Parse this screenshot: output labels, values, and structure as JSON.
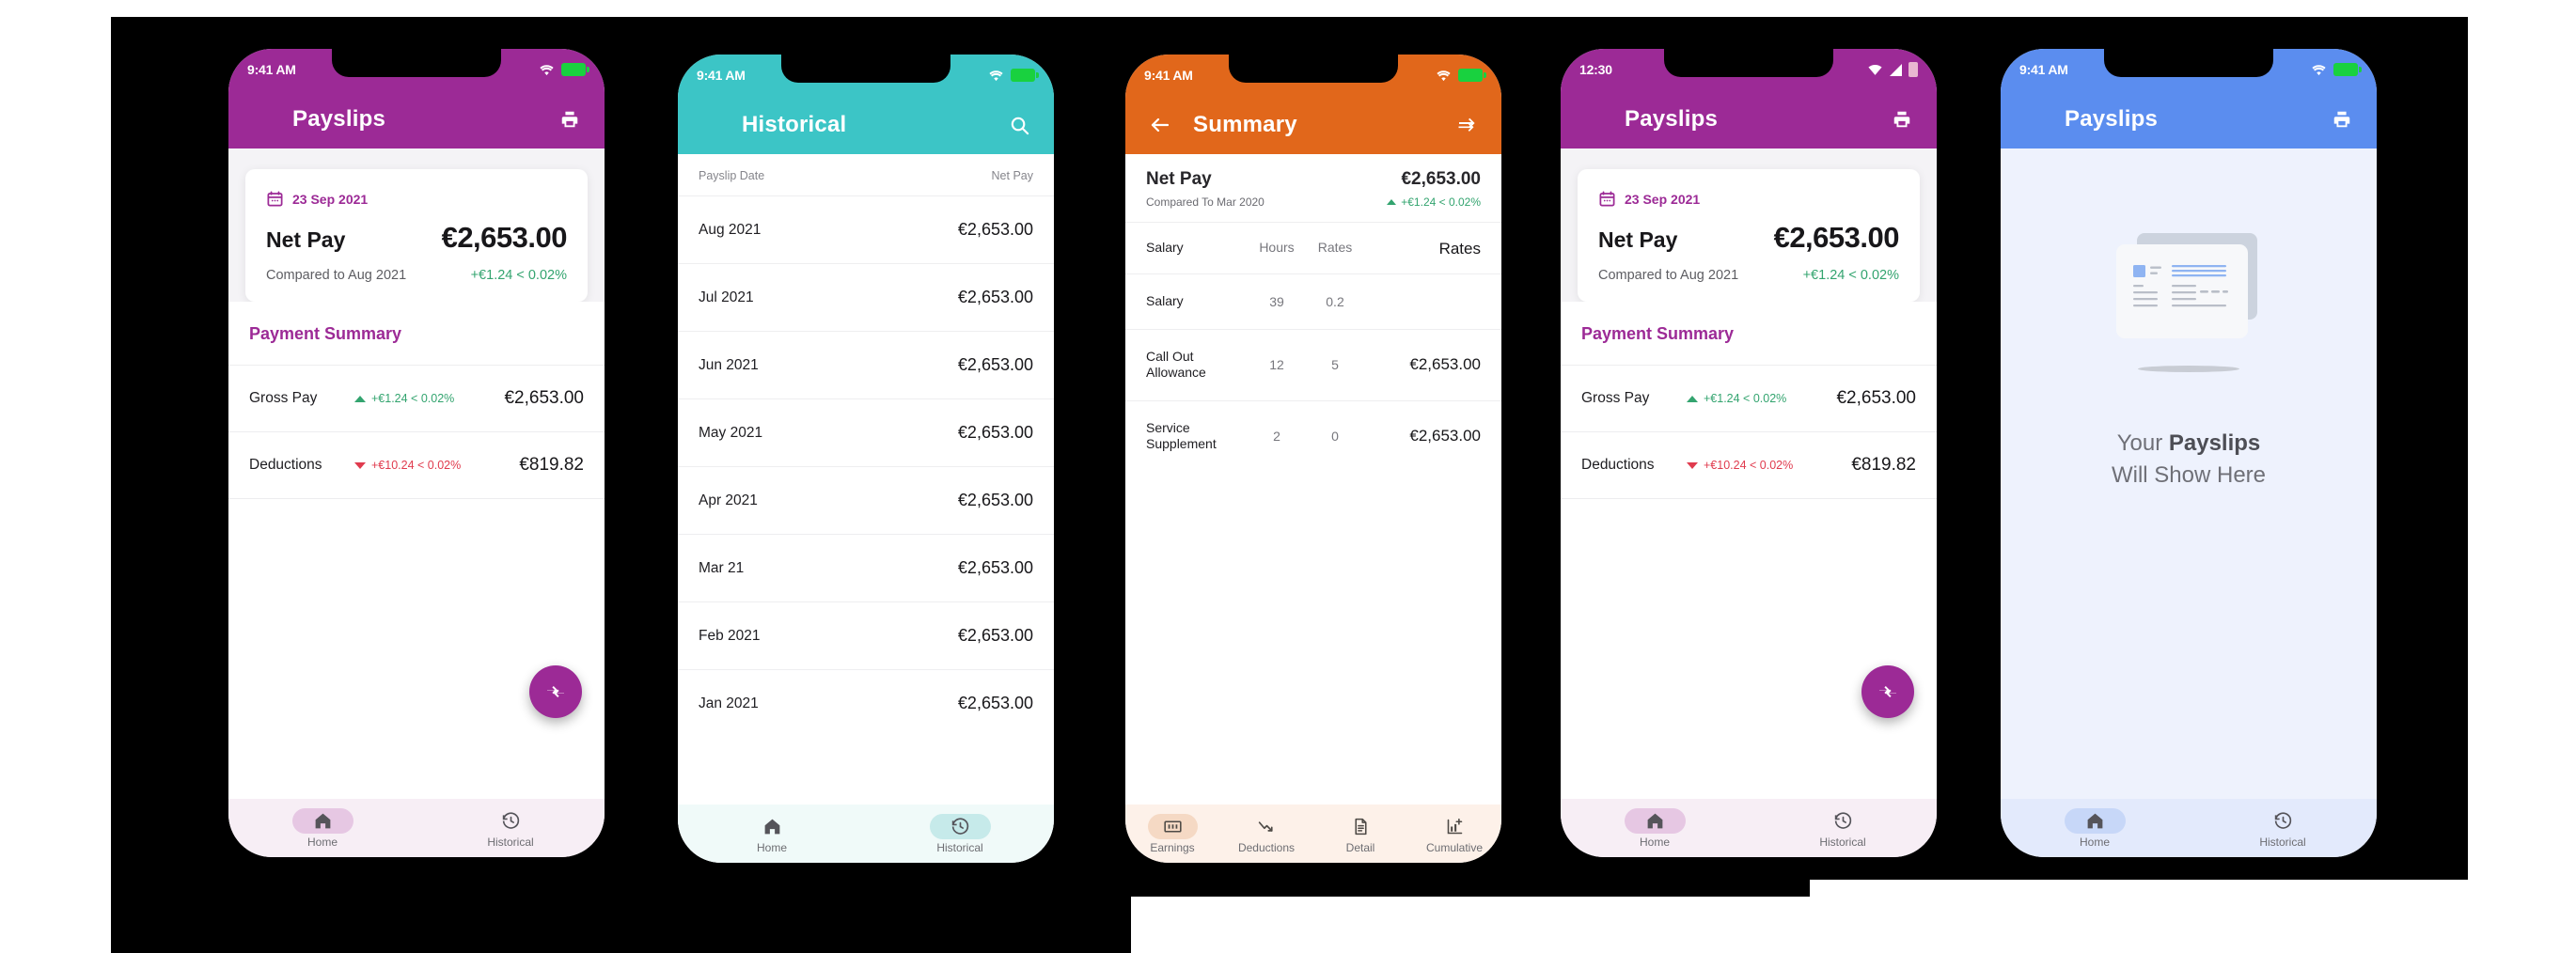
{
  "common": {
    "currency_amount": "€2,653.00",
    "net_pay_label": "Net Pay",
    "home_label": "Home",
    "historical_label": "Historical",
    "print_icon": "print-icon",
    "menu_icon": "hamburger-menu-icon",
    "colors": {
      "purple": "#9c2a96",
      "teal": "#3cc5c6",
      "orange": "#e1671b",
      "blue": "#5b8def",
      "green": "#33a46f",
      "red": "#e03b4e"
    }
  },
  "phone1": {
    "status": {
      "time": "9:41 AM",
      "wifi": "wifi-icon",
      "battery": "battery-full-icon"
    },
    "appbar": {
      "title": "Payslips",
      "menu": "hamburger-menu-icon",
      "action": "print-icon",
      "color": "#9c2a96"
    },
    "card": {
      "date": "23 Sep 2021",
      "net_pay_label": "Net Pay",
      "net_pay_amount": "€2,653.00",
      "compared_label": "Compared to Aug 2021",
      "delta": "+€1.24 < 0.02%"
    },
    "payment_summary": {
      "title": "Payment Summary",
      "rows": [
        {
          "name": "Gross Pay",
          "change": "+€1.24 < 0.02%",
          "direction": "up",
          "value": "€2,653.00"
        },
        {
          "name": "Deductions",
          "change": "+€10.24 < 0.02%",
          "direction": "down",
          "value": "€819.82"
        }
      ]
    },
    "fab": "compare-arrows-icon",
    "nav": {
      "active": "Home",
      "items": [
        {
          "label": "Home",
          "icon": "home-icon"
        },
        {
          "label": "Historical",
          "icon": "history-icon"
        }
      ]
    }
  },
  "phone2": {
    "status": {
      "time": "9:41 AM",
      "wifi": "wifi-icon",
      "battery": "battery-full-icon"
    },
    "appbar": {
      "title": "Historical",
      "menu": "hamburger-menu-icon",
      "action": "search-icon",
      "color": "#3cc5c6"
    },
    "table": {
      "col_date": "Payslip Date",
      "col_netpay": "Net Pay",
      "rows": [
        {
          "month": "Aug 2021",
          "amount": "€2,653.00"
        },
        {
          "month": "Jul 2021",
          "amount": "€2,653.00"
        },
        {
          "month": "Jun 2021",
          "amount": "€2,653.00"
        },
        {
          "month": "May 2021",
          "amount": "€2,653.00"
        },
        {
          "month": "Apr 2021",
          "amount": "€2,653.00"
        },
        {
          "month": "Mar 21",
          "amount": "€2,653.00"
        },
        {
          "month": "Feb 2021",
          "amount": "€2,653.00"
        },
        {
          "month": "Jan 2021",
          "amount": "€2,653.00"
        }
      ]
    },
    "nav": {
      "active": "Historical",
      "items": [
        {
          "label": "Home",
          "icon": "home-icon"
        },
        {
          "label": "Historical",
          "icon": "history-icon"
        }
      ]
    }
  },
  "phone3": {
    "status": {
      "time": "9:41 AM",
      "wifi": "wifi-icon",
      "battery": "battery-full-icon"
    },
    "appbar": {
      "title": "Summary",
      "back": "back-arrow-icon",
      "action": "swap-arrows-icon",
      "color": "#e1671b"
    },
    "net": {
      "label": "Net Pay",
      "amount": "€2,653.00",
      "compared_label": "Compared To Mar 2020",
      "delta": "+€1.24 < 0.02%"
    },
    "table": {
      "headers": [
        "Salary",
        "Hours",
        "Rates",
        "Rates"
      ],
      "rows": [
        {
          "name": "Salary",
          "hours": "39",
          "rates": "0.2",
          "amount": ""
        },
        {
          "name": "Call Out Allowance",
          "hours": "12",
          "rates": "5",
          "amount": "€2,653.00"
        },
        {
          "name": "Service Supplement",
          "hours": "2",
          "rates": "0",
          "amount": "€2,653.00"
        }
      ]
    },
    "nav": {
      "active": "Earnings",
      "items": [
        {
          "label": "Earnings",
          "icon": "money-note-icon"
        },
        {
          "label": "Deductions",
          "icon": "trend-down-icon"
        },
        {
          "label": "Detail",
          "icon": "document-icon"
        },
        {
          "label": "Cumulative",
          "icon": "chart-add-icon"
        }
      ]
    }
  },
  "phone4": {
    "status": {
      "time": "12:30",
      "wifi": "wifi-icon",
      "signal": "signal-icon",
      "battery": "battery-icon"
    },
    "appbar": {
      "title": "Payslips",
      "menu": "hamburger-menu-icon",
      "action": "print-icon",
      "color": "#9c2a96"
    },
    "card": {
      "date": "23 Sep 2021",
      "net_pay_label": "Net Pay",
      "net_pay_amount": "€2,653.00",
      "compared_label": "Compared to Aug 2021",
      "delta": "+€1.24 < 0.02%"
    },
    "payment_summary": {
      "title": "Payment Summary",
      "rows": [
        {
          "name": "Gross Pay",
          "change": "+€1.24 < 0.02%",
          "direction": "up",
          "value": "€2,653.00"
        },
        {
          "name": "Deductions",
          "change": "+€10.24 < 0.02%",
          "direction": "down",
          "value": "€819.82"
        }
      ]
    },
    "fab": "compare-arrows-icon",
    "nav": {
      "active": "Home",
      "items": [
        {
          "label": "Home",
          "icon": "home-icon"
        },
        {
          "label": "Historical",
          "icon": "history-icon"
        }
      ]
    }
  },
  "phone5": {
    "status": {
      "time": "9:41 AM",
      "wifi": "wifi-icon",
      "battery": "battery-full-icon"
    },
    "appbar": {
      "title": "Payslips",
      "menu": "hamburger-menu-icon",
      "action": "print-icon",
      "color": "#5b8def"
    },
    "empty": {
      "illustration": "documents-illustration",
      "line1_prefix": "Your ",
      "line1_bold": "Payslips",
      "line2": "Will Show Here"
    },
    "nav": {
      "active": "Home",
      "items": [
        {
          "label": "Home",
          "icon": "home-icon"
        },
        {
          "label": "Historical",
          "icon": "history-icon"
        }
      ]
    }
  }
}
